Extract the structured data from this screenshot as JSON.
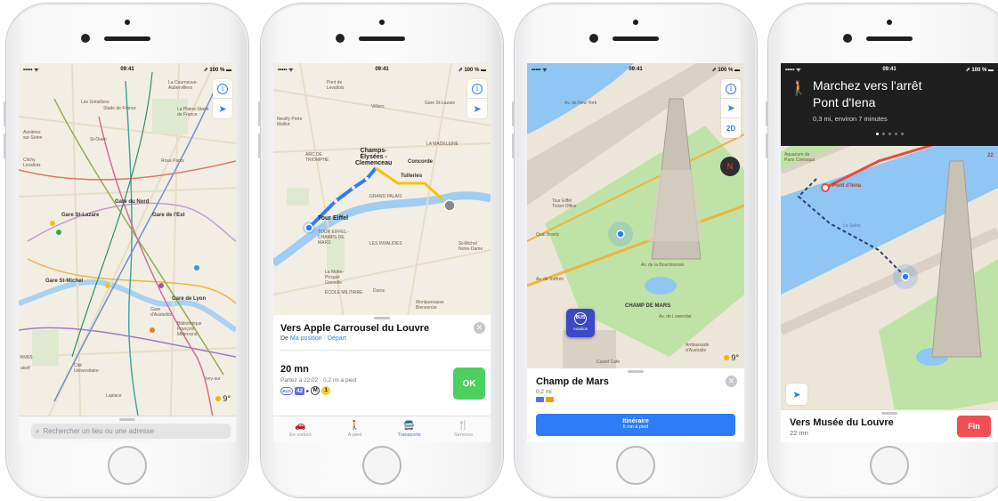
{
  "status": {
    "carrier": "••••• ᯤ",
    "time": "09:41",
    "battery": "⇗ 100 % ▬"
  },
  "icons": {
    "info": "i",
    "location": "➤",
    "close": "✕",
    "search": "⌕",
    "walk": "🚶",
    "compass": "N"
  },
  "colors": {
    "accent": "#2f7cf6",
    "ok_button": "#4cd15e",
    "end_button": "#f24f52",
    "bus": "#5b6ee8",
    "metro_line1": "#f6cd2f",
    "water": "#8fc6f3",
    "park": "#c9e8b0"
  },
  "screen1": {
    "search_placeholder": "Rechercher un lieu ou une adresse",
    "weather": "9°",
    "labels": {
      "courneuve": "La Courneuve-\nAubervilliers",
      "gresillons": "Les Grésillons",
      "stade_france": "Stade de France",
      "plaine": "La Plaine-Stade\nde France",
      "asnieres": "Asnières\nsur-Seine",
      "saint_ouen": "St-Ouen",
      "clichy": "Clichy\nLevallois",
      "rosa_parks": "Rosa Parks",
      "gare_nord": "Gare du Nord",
      "gare_st_lazare": "Gare St-Lazare",
      "gare_est": "Gare de l'Est",
      "gare_st_michel": "Gare St-Michel",
      "gare_lyon": "Gare de Lyon",
      "gare_austerlitz": "Gare\nd'Austerlitz",
      "bibliotheque": "Bibliothèque\nFrançois\nMitterrand",
      "cite_univ": "Cité\nUniversitaire",
      "laplace": "Laplace",
      "ivry": "Ivry-sur",
      "nves": "NVES",
      "akoff": "akoff"
    }
  },
  "screen2": {
    "weather_note": "",
    "map_labels": {
      "levallois": "Pont de\nLevallois",
      "neuilly": "Neuilly Porte\nMaillot",
      "villiers": "Villiers",
      "st_lazare": "Gare St-Lazare",
      "champs": "Champs-\nÉlysées -\nClemenceau",
      "concorde": "Concorde",
      "tuileries": "Tuileries",
      "tour_eiffel": "Tour Eiffel",
      "ecole": "ÉCOLE MILITAIRE",
      "champ_mars": "TOUR EIFFEL -\nCHAMPS DE\nMARS",
      "invalides": "LES INVALIDES",
      "motte": "La Motte-\nPicquet\nGrenelle",
      "duroc": "Duroc",
      "montparnasse": "Montparnasse\nBienvenüe",
      "st_michel": "St-Michel\nNotre-Dame",
      "arc": "ARC DE\nTRIOMPHE",
      "grand_palais": "GRAND PALAIS",
      "madeleine": "LA MADELEINE"
    },
    "card": {
      "title": "Vers Apple Carrousel du Louvre",
      "from_prefix": "De",
      "from_link": "Ma position",
      "from_sep": "·",
      "from_depart": "Départ",
      "duration": "20 mn",
      "details": "Partez à 22:02 · 0,2 mi à pied",
      "bus_label": "BUS",
      "bus_number": "42",
      "arrow": "▸",
      "metro_label": "M",
      "metro_line": "1",
      "ok_label": "OK"
    },
    "tabs": [
      {
        "label": "En voiture",
        "icon": "🚗",
        "active": false
      },
      {
        "label": "À pied",
        "icon": "🚶",
        "active": false
      },
      {
        "label": "Transports",
        "icon": "🚍",
        "active": true
      },
      {
        "label": "Services",
        "icon": "🍴",
        "active": false
      }
    ]
  },
  "screen3": {
    "map_labels": {
      "av_new_york": "Av. de New York",
      "tour_eiffel": "Tour Eiffel\nTicket Office",
      "quai": "Quai Branly",
      "av_suffren": "Av. de Suffren",
      "av_lowendal": "Av. de Lowendal",
      "ambassade": "Ambassade\nd'Australie",
      "castel": "Castel Cafe",
      "av_bourdonnais": "Av. de la Bourdonnais",
      "champ_mars": "CHAMP DE MARS"
    },
    "controls_2d": "2D",
    "bus_tile_label": "BUS",
    "bus_tile_name": "Autolion",
    "weather": "9°",
    "card": {
      "title": "Champ de Mars",
      "distance": "0,2 mi",
      "button_title": "Itinéraire",
      "button_sub": "5 mn à pied"
    }
  },
  "screen4": {
    "banner": {
      "line1": "Marchez vers l'arrêt",
      "line2": "Pont d'Iena",
      "sub": "0,3 mi, environ 7 minutes"
    },
    "map_labels": {
      "aquarium": "Aquarium de\nParis Cinéaqua",
      "pont_iena": "Pont d'Iena",
      "la_seine": "La Seine",
      "bus_22": "22"
    },
    "bottom": {
      "title": "Vers Musée du Louvre",
      "duration": "22 mn",
      "end_label": "Fin"
    }
  }
}
